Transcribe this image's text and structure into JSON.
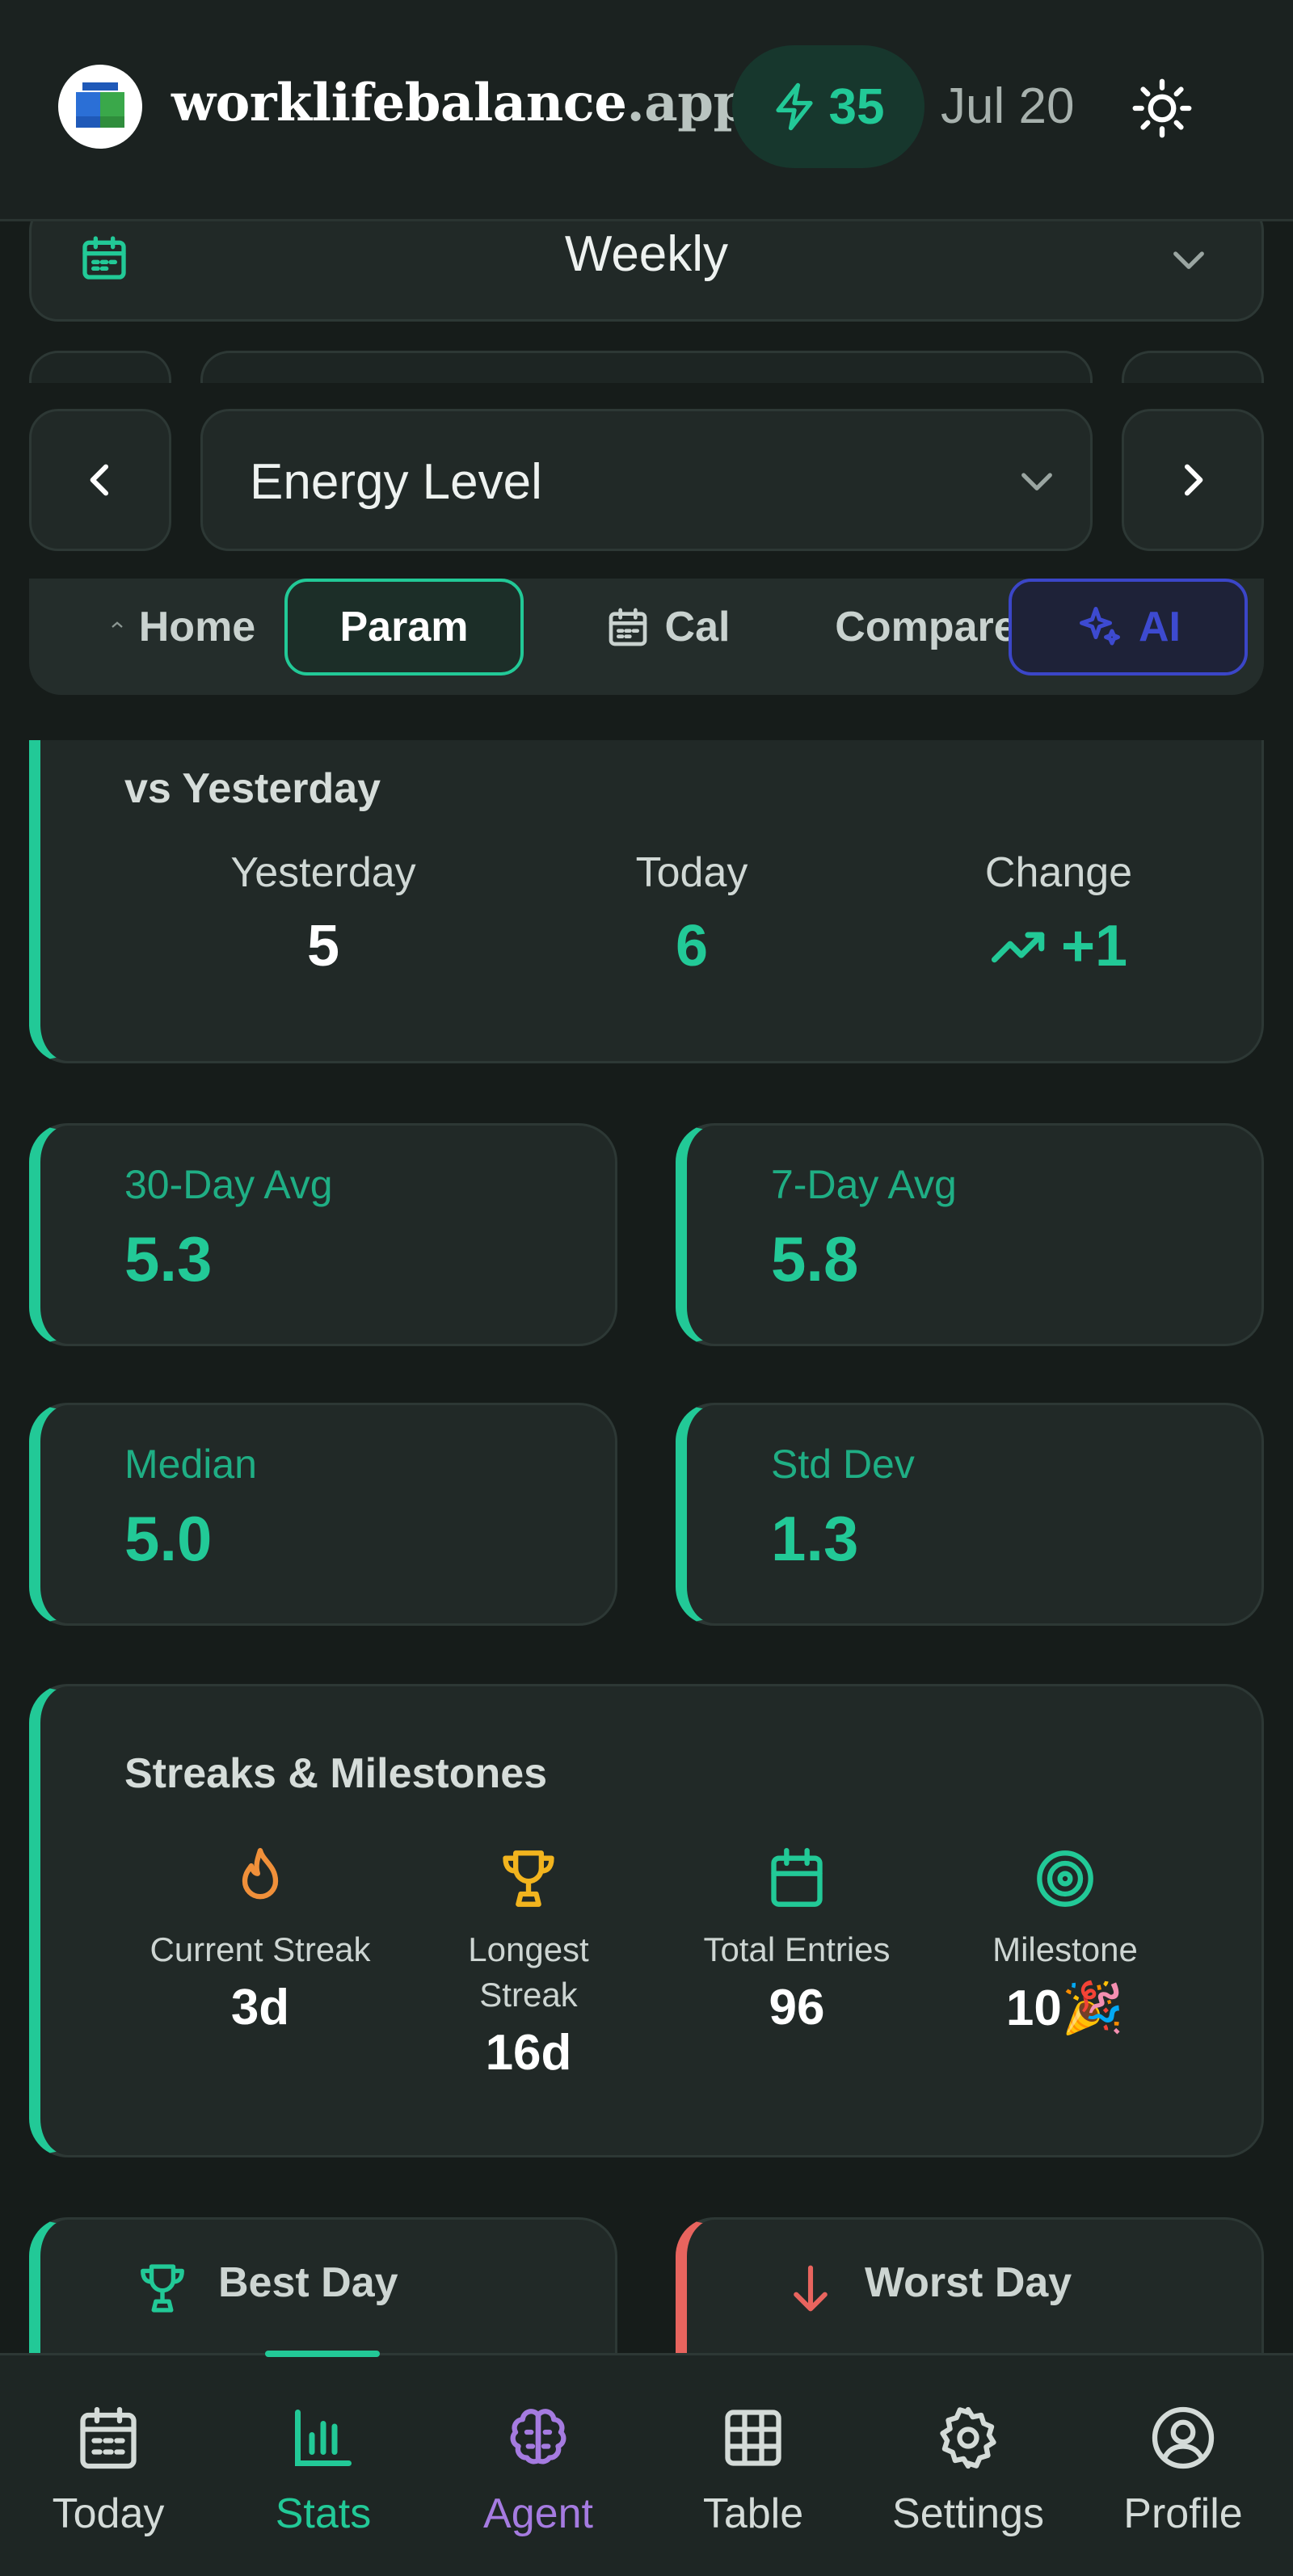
{
  "header": {
    "brand_name": "worklifebalance",
    "brand_tld": ".app",
    "energy_count": "35",
    "date": "Jul 20",
    "icons": {
      "energy": "bolt-icon",
      "theme": "sun-icon",
      "logo": "app-logo"
    }
  },
  "period_select": {
    "value": "Weekly",
    "icon": "calendar-icon"
  },
  "parameter_select": {
    "value": "Energy Level"
  },
  "tabs": [
    {
      "label": "Home"
    },
    {
      "label": "Param"
    },
    {
      "label": "Cal"
    },
    {
      "label": "Compare"
    },
    {
      "label": "AI"
    }
  ],
  "comparison": {
    "title": "vs Yesterday",
    "yesterday_label": "Yesterday",
    "yesterday_value": "5",
    "today_label": "Today",
    "today_value": "6",
    "change_label": "Change",
    "change_value": "+1"
  },
  "stats": [
    {
      "label": "30-Day Avg",
      "value": "5.3"
    },
    {
      "label": "7-Day Avg",
      "value": "5.8"
    },
    {
      "label": "Median",
      "value": "5.0"
    },
    {
      "label": "Std Dev",
      "value": "1.3"
    }
  ],
  "streaks": {
    "title": "Streaks & Milestones",
    "items": [
      {
        "label": "Current Streak",
        "value": "3d",
        "icon": "flame-icon"
      },
      {
        "label": "Longest Streak",
        "value": "16d",
        "icon": "trophy-icon"
      },
      {
        "label": "Total Entries",
        "value": "96",
        "icon": "calendar-icon"
      },
      {
        "label": "Milestone",
        "value": "10🎉",
        "icon": "target-icon"
      }
    ]
  },
  "best_day": {
    "title": "Best Day"
  },
  "worst_day": {
    "title": "Worst Day"
  },
  "bottom_nav": [
    {
      "label": "Today"
    },
    {
      "label": "Stats"
    },
    {
      "label": "Agent"
    },
    {
      "label": "Table"
    },
    {
      "label": "Settings"
    },
    {
      "label": "Profile"
    }
  ],
  "colors": {
    "accent": "#22c997",
    "danger": "#e8645e",
    "agent": "#a57be0",
    "ai": "#3b46c8",
    "background": "#161c1a"
  }
}
